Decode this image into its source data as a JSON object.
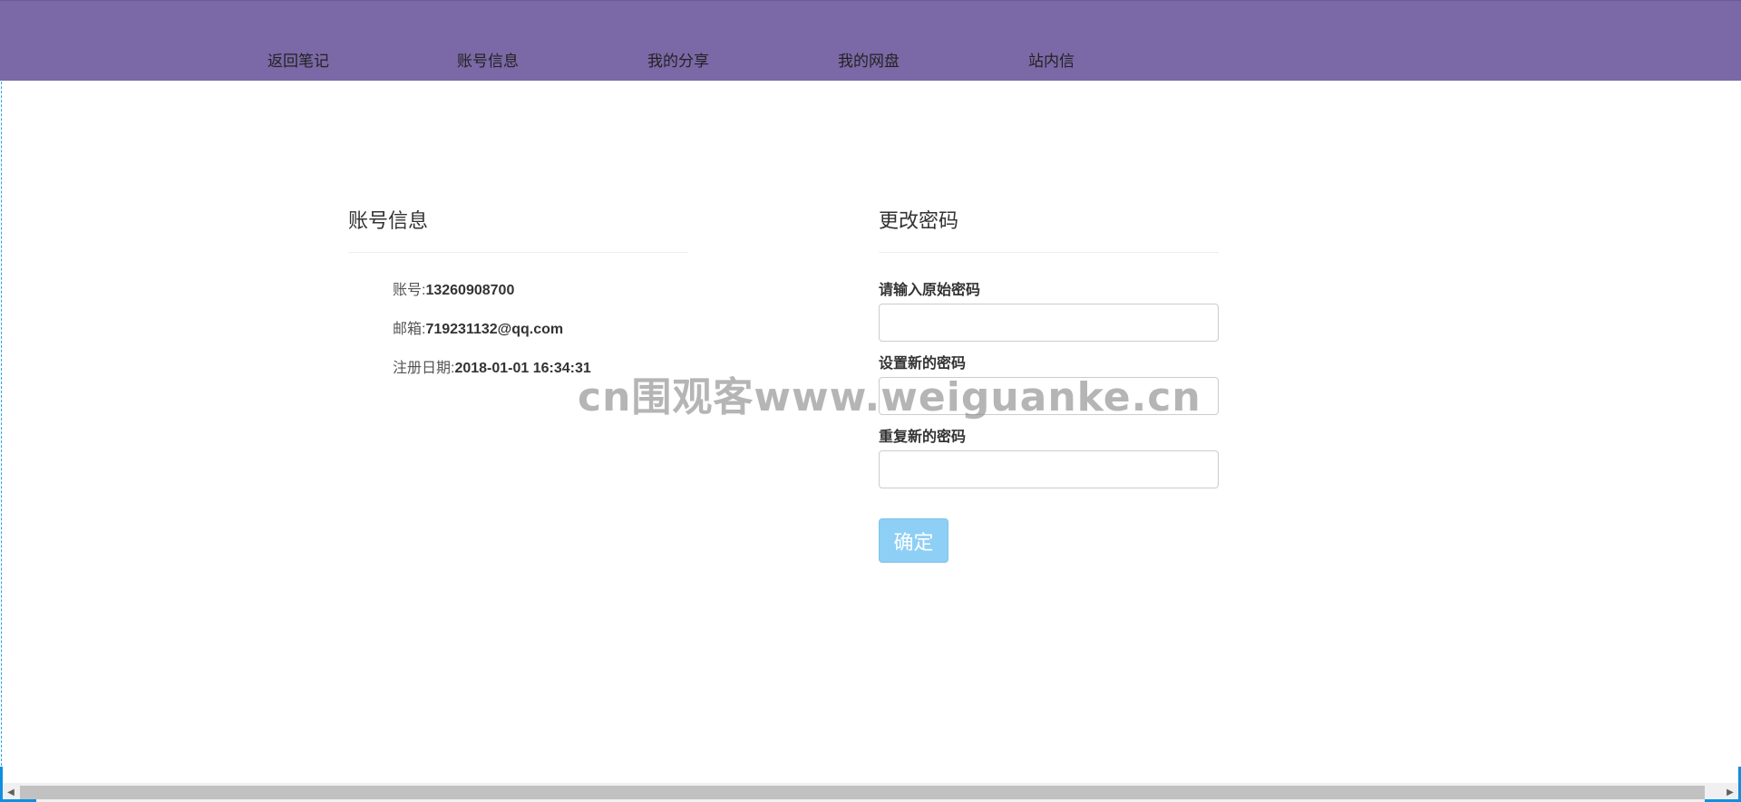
{
  "nav": {
    "items": [
      {
        "label": "返回笔记"
      },
      {
        "label": "账号信息"
      },
      {
        "label": "我的分享"
      },
      {
        "label": "我的网盘"
      },
      {
        "label": "站内信"
      }
    ],
    "background_color": "#7b68a6"
  },
  "account": {
    "title": "账号信息",
    "rows": [
      {
        "key": "账号:",
        "value": "13260908700"
      },
      {
        "key": "邮箱:",
        "value": "719231132@qq.com"
      },
      {
        "key": "注册日期:",
        "value": "2018-01-01 16:34:31"
      }
    ]
  },
  "password": {
    "title": "更改密码",
    "fields": [
      {
        "label": "请输入原始密码",
        "value": ""
      },
      {
        "label": "设置新的密码",
        "value": ""
      },
      {
        "label": "重复新的密码",
        "value": ""
      }
    ],
    "submit_label": "确定",
    "submit_color": "#8ecff5"
  },
  "watermark": "cn围观客www.weiguanke.cn",
  "scrollbar": {
    "left_arrow": "◀",
    "right_arrow": "▶"
  }
}
